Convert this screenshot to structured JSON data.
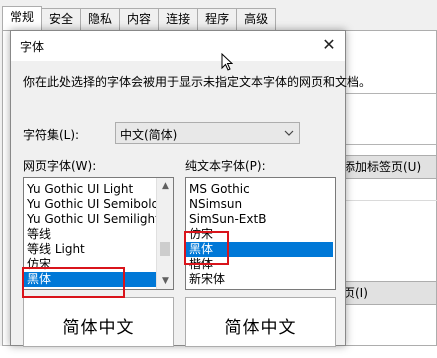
{
  "background_window": {
    "tabs": [
      "常规",
      "安全",
      "隐私",
      "内容",
      "连接",
      "程序",
      "高级"
    ],
    "button_tabs_label": "添加标签页(U)",
    "button_delete_label": "页(I)"
  },
  "dialog": {
    "title": "字体",
    "close_glyph": "✕",
    "description": "你在此处选择的字体会被用于显示未指定文本字体的网页和文档。",
    "charset": {
      "label": "字符集(L):",
      "value": "中文(简体)"
    },
    "webpage_fonts": {
      "label": "网页字体(W):",
      "items": [
        "Yu Gothic UI Light",
        "Yu Gothic UI Semibold",
        "Yu Gothic UI Semilight",
        "等线",
        "等线 Light",
        "仿宋",
        "黑体"
      ],
      "selected": "黑体",
      "preview": "简体中文"
    },
    "plaintext_fonts": {
      "label": "纯文本字体(P):",
      "items": [
        "MS Gothic",
        "NSimsun",
        "SimSun-ExtB",
        "仿宋",
        "黑体",
        "楷体",
        "新宋体"
      ],
      "selected": "黑体",
      "preview": "简体中文"
    }
  },
  "colors": {
    "selection": "#0078d7",
    "highlight_box": "#d9141b"
  }
}
